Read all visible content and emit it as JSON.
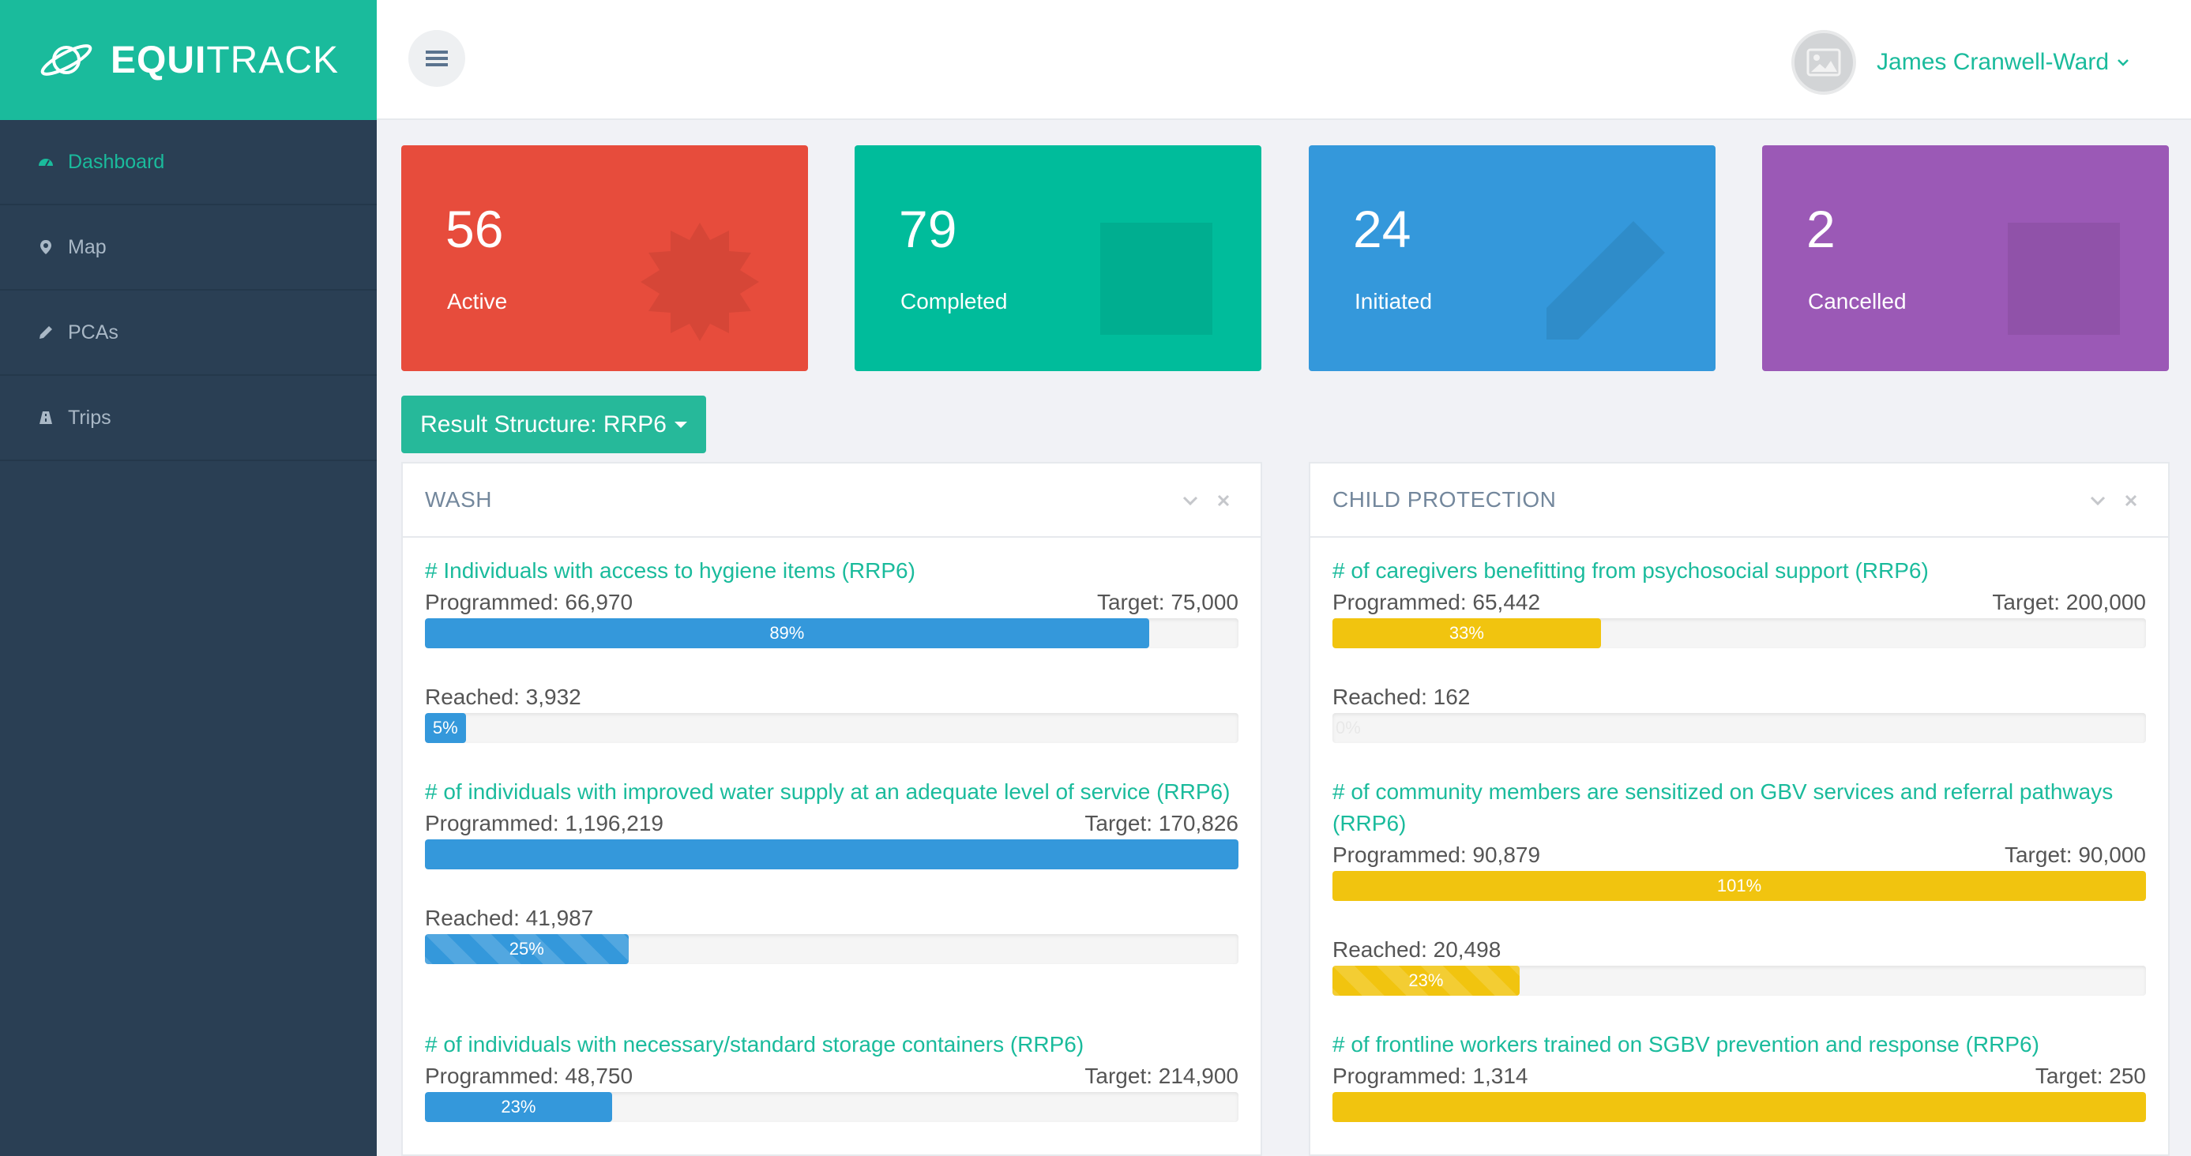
{
  "brand": {
    "bold": "EQUI",
    "light": "TRACK"
  },
  "sidebar": {
    "items": [
      {
        "label": "Dashboard",
        "icon": "dashboard-icon",
        "active": true
      },
      {
        "label": "Map",
        "icon": "map-marker-icon"
      },
      {
        "label": "PCAs",
        "icon": "pencil-icon"
      },
      {
        "label": "Trips",
        "icon": "road-icon"
      }
    ]
  },
  "header": {
    "user_name": "James Cranwell-Ward"
  },
  "tiles": [
    {
      "value": "56",
      "label": "Active",
      "color": "#e74c3c"
    },
    {
      "value": "79",
      "label": "Completed",
      "color": "#00bc9b"
    },
    {
      "value": "24",
      "label": "Initiated",
      "color": "#3498db"
    },
    {
      "value": "2",
      "label": "Cancelled",
      "color": "#9b59b6"
    }
  ],
  "result_structure": {
    "label": "Result Structure: RRP6"
  },
  "panels": [
    {
      "title": "WASH",
      "color": "#3498db",
      "indicators": [
        {
          "title": "# Individuals with access to hygiene items (RRP6)",
          "programmed": "Programmed: 66,970",
          "target": "Target: 75,000",
          "programmed_pct": 89,
          "programmed_label": "89%",
          "reached": "Reached: 3,932",
          "reached_pct": 5,
          "reached_label": "5%"
        },
        {
          "title": "# of individuals with improved water supply at an adequate level of service (RRP6)",
          "programmed": "Programmed: 1,196,219",
          "target": "Target: 170,826",
          "programmed_pct": 100,
          "programmed_label": "",
          "reached": "Reached: 41,987",
          "reached_pct": 25,
          "reached_label": "25%"
        },
        {
          "title": "# of individuals with necessary/standard storage containers (RRP6)",
          "programmed": "Programmed: 48,750",
          "target": "Target: 214,900",
          "programmed_pct": 23,
          "programmed_label": "23%"
        }
      ]
    },
    {
      "title": "CHILD PROTECTION",
      "color": "#f1c40f",
      "indicators": [
        {
          "title": "# of caregivers benefitting from psychosocial support (RRP6)",
          "programmed": "Programmed: 65,442",
          "target": "Target: 200,000",
          "programmed_pct": 33,
          "programmed_label": "33%",
          "reached": "Reached: 162",
          "reached_pct": 0,
          "reached_label": "0%"
        },
        {
          "title": "# of community members are sensitized on GBV services and referral pathways (RRP6)",
          "programmed": "Programmed: 90,879",
          "target": "Target: 90,000",
          "programmed_pct": 100,
          "programmed_label": "101%",
          "reached": "Reached: 20,498",
          "reached_pct": 23,
          "reached_label": "23%"
        },
        {
          "title": "# of frontline workers trained on SGBV prevention and response (RRP6)",
          "programmed": "Programmed: 1,314",
          "target": "Target: 250",
          "programmed_pct": 100,
          "programmed_label": ""
        }
      ]
    }
  ]
}
